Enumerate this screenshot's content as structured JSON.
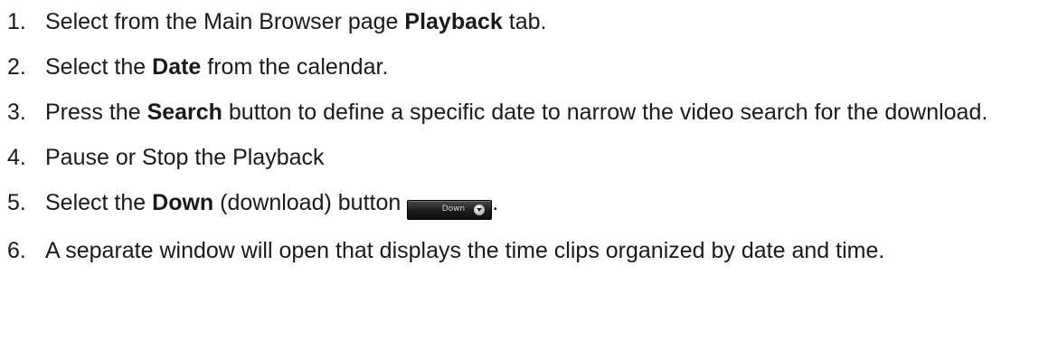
{
  "steps": [
    {
      "number": "1.",
      "pre": "Select from the Main Browser page ",
      "bold": "Playback",
      "post": " tab."
    },
    {
      "number": "2.",
      "pre": "Select the ",
      "bold": "Date",
      "post": " from the calendar."
    },
    {
      "number": "3.",
      "pre": "Press the ",
      "bold": "Search",
      "post": " button to define a specific date to narrow the video search for the download."
    },
    {
      "number": "4.",
      "text": "Pause or Stop the Playback"
    },
    {
      "number": "5.",
      "pre": "Select the ",
      "bold": "Down",
      "mid": " (download) button ",
      "button_label": "Down",
      "post": "."
    },
    {
      "number": "6.",
      "text": "A separate window will open that displays the time clips organized by date and time."
    }
  ]
}
